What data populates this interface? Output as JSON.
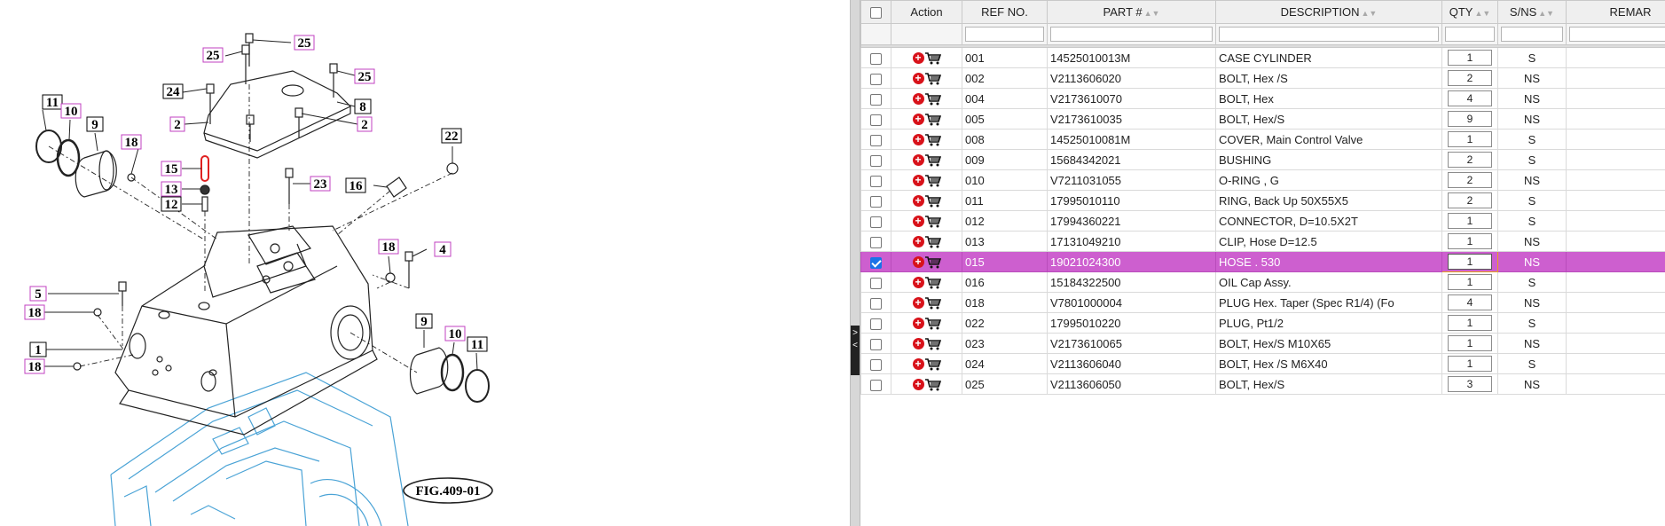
{
  "diagram": {
    "figure_label": "FIG.409-01",
    "callouts": {
      "c25a": "25",
      "c25b": "25",
      "c25c": "25",
      "c24": "24",
      "c8": "8",
      "c2a": "2",
      "c2b": "2",
      "c11a": "11",
      "c10a": "10",
      "c9a": "9",
      "c18a": "18",
      "c15": "15",
      "c13": "13",
      "c12": "12",
      "c23": "23",
      "c16": "16",
      "c22": "22",
      "c18b": "18",
      "c4": "4",
      "c5": "5",
      "c18c": "18",
      "c1": "1",
      "c18d": "18",
      "c9b": "9",
      "c10b": "10",
      "c11b": "11"
    },
    "colors": {
      "callout_highlight": "#c040c0",
      "callout_plain": "#000000",
      "line": "#222222",
      "base_part": "#4aa3d6",
      "highlight_part": "#e02020"
    }
  },
  "table": {
    "headers": {
      "action": "Action",
      "ref": "REF NO.",
      "part": "PART #",
      "description": "DESCRIPTION",
      "qty": "QTY",
      "sns": "S/NS",
      "remarks": "REMAR"
    },
    "sort_glyph": "▲▼",
    "rows": [
      {
        "ref": "001",
        "part": "14525010013M",
        "desc": "CASE CYLINDER",
        "qty": "1",
        "sns": "S",
        "selected": false
      },
      {
        "ref": "002",
        "part": "V2113606020",
        "desc": "BOLT, Hex /S",
        "qty": "2",
        "sns": "NS",
        "selected": false
      },
      {
        "ref": "004",
        "part": "V2173610070",
        "desc": "BOLT, Hex",
        "qty": "4",
        "sns": "NS",
        "selected": false
      },
      {
        "ref": "005",
        "part": "V2173610035",
        "desc": "BOLT, Hex/S",
        "qty": "9",
        "sns": "NS",
        "selected": false
      },
      {
        "ref": "008",
        "part": "14525010081M",
        "desc": "COVER, Main Control Valve",
        "qty": "1",
        "sns": "S",
        "selected": false
      },
      {
        "ref": "009",
        "part": "15684342021",
        "desc": "BUSHING",
        "qty": "2",
        "sns": "S",
        "selected": false
      },
      {
        "ref": "010",
        "part": "V7211031055",
        "desc": "O-RING , G",
        "qty": "2",
        "sns": "NS",
        "selected": false
      },
      {
        "ref": "011",
        "part": "17995010110",
        "desc": "RING, Back Up 50X55X5",
        "qty": "2",
        "sns": "S",
        "selected": false
      },
      {
        "ref": "012",
        "part": "17994360221",
        "desc": "CONNECTOR, D=10.5X2T",
        "qty": "1",
        "sns": "S",
        "selected": false
      },
      {
        "ref": "013",
        "part": "17131049210",
        "desc": "CLIP, Hose D=12.5",
        "qty": "1",
        "sns": "NS",
        "selected": false
      },
      {
        "ref": "015",
        "part": "19021024300",
        "desc": "HOSE . 530",
        "qty": "1",
        "sns": "NS",
        "selected": true
      },
      {
        "ref": "016",
        "part": "15184322500",
        "desc": "OIL Cap Assy.",
        "qty": "1",
        "sns": "S",
        "selected": false
      },
      {
        "ref": "018",
        "part": "V7801000004",
        "desc": "PLUG Hex. Taper (Spec R1/4) (Fo",
        "qty": "4",
        "sns": "NS",
        "selected": false
      },
      {
        "ref": "022",
        "part": "17995010220",
        "desc": "PLUG, Pt1/2",
        "qty": "1",
        "sns": "S",
        "selected": false
      },
      {
        "ref": "023",
        "part": "V2173610065",
        "desc": "BOLT, Hex/S M10X65",
        "qty": "1",
        "sns": "NS",
        "selected": false
      },
      {
        "ref": "024",
        "part": "V2113606040",
        "desc": "BOLT, Hex /S M6X40",
        "qty": "1",
        "sns": "S",
        "selected": false
      },
      {
        "ref": "025",
        "part": "V2113606050",
        "desc": "BOLT, Hex/S",
        "qty": "3",
        "sns": "NS",
        "selected": false
      }
    ],
    "row_icons": {
      "add": "add-circle-icon",
      "cart": "cart-icon"
    },
    "colors": {
      "selected_row": "#cd5fcf",
      "header_bg": "#efefef",
      "add_icon": "#d8121a"
    }
  },
  "splitter": {
    "handle_glyphs": "> <"
  }
}
